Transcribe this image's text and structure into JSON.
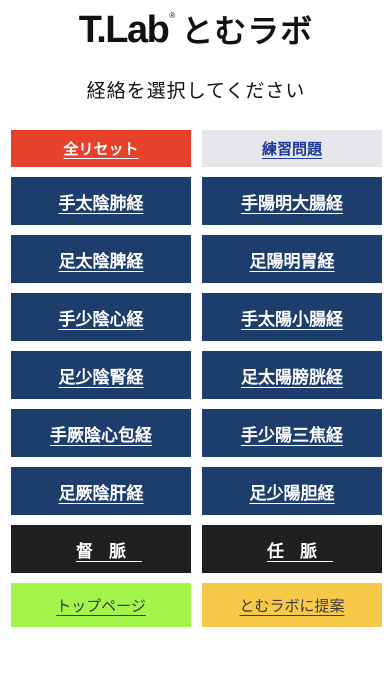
{
  "header": {
    "logo_text_en": "T.Lab",
    "logo_registered": "®",
    "logo_text_ja": "とむラボ",
    "instruction": "経絡を選択してください"
  },
  "actions": {
    "reset_label": "全リセット",
    "practice_label": "練習問題"
  },
  "meridians": [
    [
      "手太陰肺経",
      "手陽明大腸経"
    ],
    [
      "足太陰脾経",
      "足陽明胃経"
    ],
    [
      "手少陰心経",
      "手太陽小腸経"
    ],
    [
      "足少陰腎経",
      "足太陽膀胱経"
    ],
    [
      "手厥陰心包経",
      "手少陽三焦経"
    ],
    [
      "足厥陰肝経",
      "足少陽胆経"
    ]
  ],
  "vessels": {
    "governing_label": "督脈",
    "conception_label": "任脈"
  },
  "footer": {
    "top_page_label": "トップページ",
    "propose_label": "とむラボに提案"
  },
  "colors": {
    "meridian_button": "#1d3d6c",
    "vessel_button": "#1f1f1f",
    "reset_button": "#e8412b",
    "practice_button": "#e6e6ea",
    "practice_text": "#1f3b99",
    "top_page_button": "#a4f54b",
    "propose_button": "#f7c948"
  }
}
